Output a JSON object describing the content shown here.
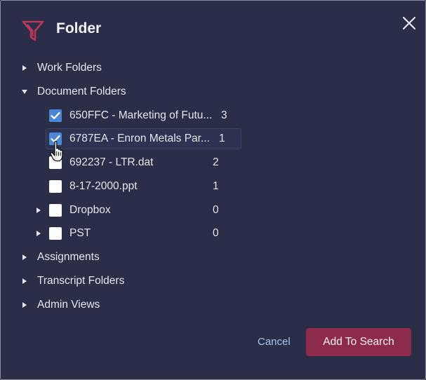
{
  "dialog": {
    "title": "Folder",
    "close_icon": "close-icon",
    "filter_icon": "filter-icon"
  },
  "tree": {
    "work_folders": "Work Folders",
    "document_folders": "Document Folders",
    "items": [
      {
        "label": "650FFC - Marketing of Futu...",
        "count": "3",
        "checked": true
      },
      {
        "label": "6787EA - Enron Metals Par...",
        "count": "1",
        "checked": true
      },
      {
        "label": "692237 - LTR.dat",
        "count": "2",
        "checked": false
      },
      {
        "label": "8-17-2000.ppt",
        "count": "1",
        "checked": false
      },
      {
        "label": "Dropbox",
        "count": "0",
        "checked": false
      },
      {
        "label": "PST",
        "count": "0",
        "checked": false
      }
    ],
    "assignments": "Assignments",
    "transcript_folders": "Transcript Folders",
    "admin_views": "Admin Views"
  },
  "footer": {
    "cancel_label": "Cancel",
    "add_label": "Add To Search"
  },
  "colors": {
    "background": "#2a2f47",
    "accent_button": "#8d2b4d",
    "filter_icon": "#b8355a",
    "checkbox_checked": "#4e86d6",
    "link": "#a9c3ea"
  }
}
